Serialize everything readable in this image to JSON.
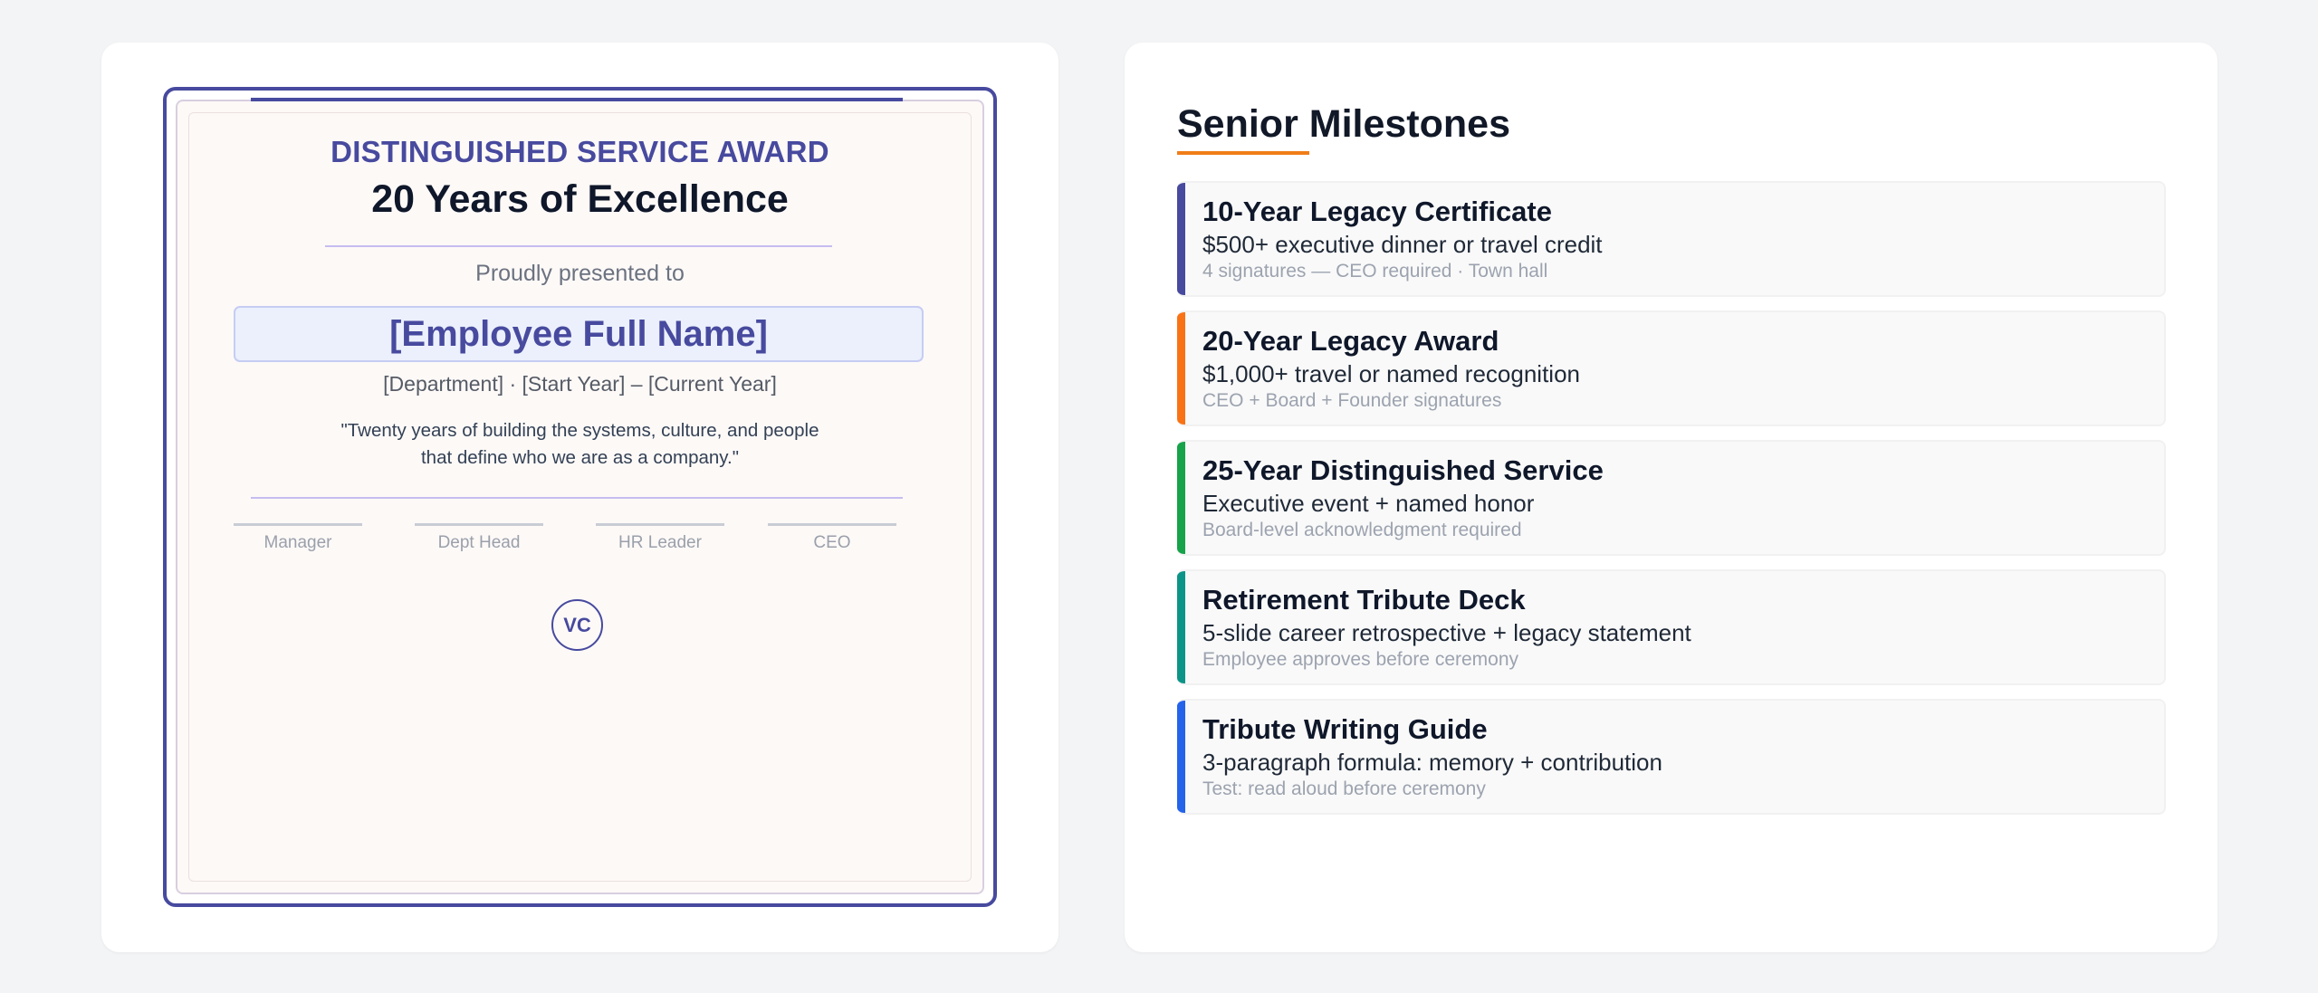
{
  "certificate": {
    "award_title": "DISTINGUISHED SERVICE AWARD",
    "award_subtitle": "20 Years of Excellence",
    "presented_to": "Proudly presented to",
    "employee_name": "[Employee Full Name]",
    "department_line": "[Department]  ·  [Start Year] – [Current Year]",
    "quote_line1": "\"Twenty years of building the systems, culture, and people",
    "quote_line2": "that define who we are as a company.\"",
    "signatures": [
      "Manager",
      "Dept Head",
      "HR Leader",
      "CEO"
    ],
    "monogram": "VC",
    "accent_color": "#474a9e"
  },
  "panel": {
    "title": "Senior Milestones",
    "underline_color": "#f07d18",
    "items": [
      {
        "title": "10-Year Legacy Certificate",
        "description": "$500+ executive dinner or travel credit",
        "note": "4 signatures — CEO required · Town hall",
        "color": "#474a9e"
      },
      {
        "title": "20-Year Legacy Award",
        "description": "$1,000+ travel or named recognition",
        "note": "CEO + Board + Founder signatures",
        "color": "#f97316"
      },
      {
        "title": "25-Year Distinguished Service",
        "description": "Executive event + named honor",
        "note": "Board-level acknowledgment required",
        "color": "#16a34a"
      },
      {
        "title": "Retirement Tribute Deck",
        "description": "5-slide career retrospective + legacy statement",
        "note": "Employee approves before ceremony",
        "color": "#0d9488"
      },
      {
        "title": "Tribute Writing Guide",
        "description": "3-paragraph formula: memory + contribution",
        "note": "Test: read aloud before ceremony",
        "color": "#2563eb"
      }
    ]
  }
}
